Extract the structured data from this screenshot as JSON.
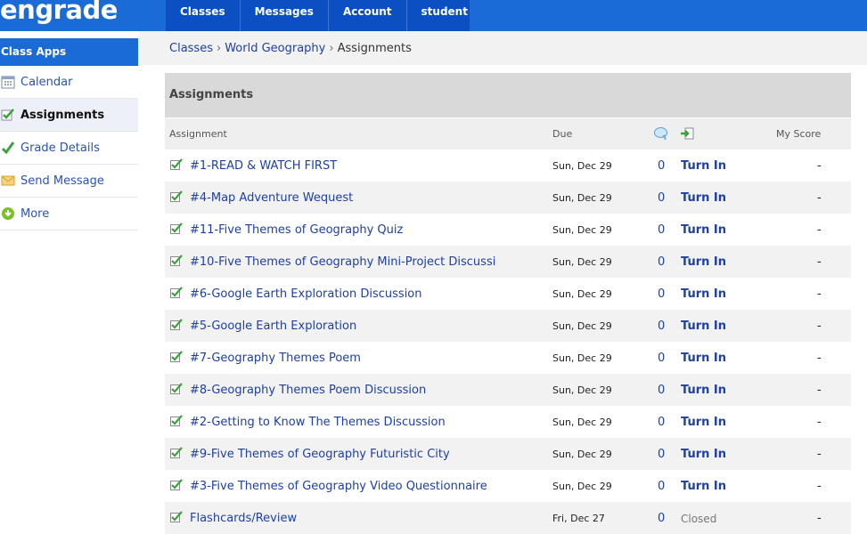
{
  "app": {
    "logo": "engrade"
  },
  "nav": [
    "Classes",
    "Messages",
    "Account",
    "student"
  ],
  "breadcrumb": {
    "part1": "Classes",
    "sep1": "›",
    "part2": "World Geography",
    "sep2": "›",
    "current": "Assignments"
  },
  "sidebar": {
    "heading": "Class Apps",
    "items": [
      {
        "label": "Calendar",
        "icon": "calendar-icon"
      },
      {
        "label": "Assignments",
        "icon": "check-icon",
        "active": true
      },
      {
        "label": "Grade Details",
        "icon": "check-icon"
      },
      {
        "label": "Send Message",
        "icon": "envelope-icon"
      },
      {
        "label": "More",
        "icon": "down-arrow-icon"
      }
    ]
  },
  "panel": {
    "title": "Assignments",
    "headers": {
      "assignment": "Assignment",
      "due": "Due",
      "comments_icon": "comment-bubble-icon",
      "turnin_icon": "turn-in-arrow-icon",
      "score": "My Score"
    },
    "rows": [
      {
        "name": "#1-READ & WATCH FIRST",
        "due": "Sun, Dec 29",
        "count": "0",
        "action": "Turn In",
        "score": "-"
      },
      {
        "name": "#4-Map Adventure Wequest",
        "due": "Sun, Dec 29",
        "count": "0",
        "action": "Turn In",
        "score": "-"
      },
      {
        "name": "#11-Five Themes of Geography Quiz",
        "due": "Sun, Dec 29",
        "count": "0",
        "action": "Turn In",
        "score": "-"
      },
      {
        "name": "#10-Five Themes of Geography Mini-Project Discussi",
        "due": "Sun, Dec 29",
        "count": "0",
        "action": "Turn In",
        "score": "-"
      },
      {
        "name": "#6-Google Earth Exploration Discussion",
        "due": "Sun, Dec 29",
        "count": "0",
        "action": "Turn In",
        "score": "-"
      },
      {
        "name": "#5-Google Earth Exploration",
        "due": "Sun, Dec 29",
        "count": "0",
        "action": "Turn In",
        "score": "-"
      },
      {
        "name": "#7-Geography Themes Poem",
        "due": "Sun, Dec 29",
        "count": "0",
        "action": "Turn In",
        "score": "-"
      },
      {
        "name": "#8-Geography Themes Poem Discussion",
        "due": "Sun, Dec 29",
        "count": "0",
        "action": "Turn In",
        "score": "-"
      },
      {
        "name": "#2-Getting to Know The Themes Discussion",
        "due": "Sun, Dec 29",
        "count": "0",
        "action": "Turn In",
        "score": "-"
      },
      {
        "name": "#9-Five Themes of Geography Futuristic City",
        "due": "Sun, Dec 29",
        "count": "0",
        "action": "Turn In",
        "score": "-"
      },
      {
        "name": "#3-Five Themes of Geography Video Questionnaire",
        "due": "Sun, Dec 29",
        "count": "0",
        "action": "Turn In",
        "score": "-"
      },
      {
        "name": "Flashcards/Review",
        "due": "Fri, Dec 27",
        "count": "0",
        "action": "Closed",
        "score": "-"
      }
    ]
  },
  "colors": {
    "topbar": "#1a6bd6",
    "nav": "#0b4fc2",
    "link": "#1d3fa6",
    "check": "#3aa33a"
  }
}
